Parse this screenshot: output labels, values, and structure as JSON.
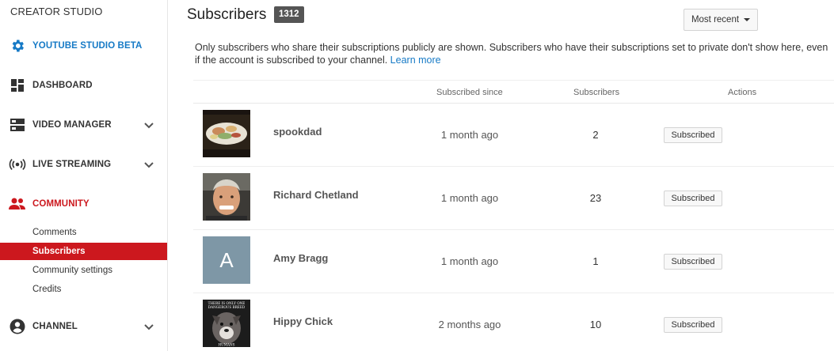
{
  "sidebar": {
    "brand": "CREATOR STUDIO",
    "items": [
      {
        "label": "YOUTUBE STUDIO BETA",
        "icon": "gear-icon"
      },
      {
        "label": "DASHBOARD",
        "icon": "dashboard-icon"
      },
      {
        "label": "VIDEO MANAGER",
        "icon": "video-manager-icon"
      },
      {
        "label": "LIVE STREAMING",
        "icon": "live-streaming-icon"
      },
      {
        "label": "COMMUNITY",
        "icon": "community-icon"
      },
      {
        "label": "CHANNEL",
        "icon": "account-icon"
      }
    ],
    "community_sub": [
      "Comments",
      "Subscribers",
      "Community settings",
      "Credits"
    ]
  },
  "header": {
    "title": "Subscribers",
    "count": "1312",
    "sort_label": "Most recent"
  },
  "notice": {
    "text": "Only subscribers who share their subscriptions publicly are shown. Subscribers who have their subscriptions set to private don't show here, even if the account is subscribed to your channel. ",
    "link": "Learn more"
  },
  "table": {
    "columns": [
      "Subscribed since",
      "Subscribers",
      "Actions"
    ],
    "rows": [
      {
        "name": "spookdad",
        "since": "1 month ago",
        "subscribers": "2",
        "action": "Subscribed",
        "avatar": "food-photo"
      },
      {
        "name": "Richard Chetland",
        "since": "1 month ago",
        "subscribers": "23",
        "action": "Subscribed",
        "avatar": "portrait-photo"
      },
      {
        "name": "Amy Bragg",
        "since": "1 month ago",
        "subscribers": "1",
        "action": "Subscribed",
        "avatar_letter": "A"
      },
      {
        "name": "Hippy Chick",
        "since": "2 months ago",
        "subscribers": "10",
        "action": "Subscribed",
        "avatar": "dog-photo",
        "avatar_text": [
          "THERE IS ONLY ONE",
          "DANGEROUS BREED",
          "HUMANS"
        ]
      }
    ]
  },
  "colors": {
    "accent_red": "#cc181e",
    "accent_blue": "#167ac6",
    "badge": "#555555"
  }
}
